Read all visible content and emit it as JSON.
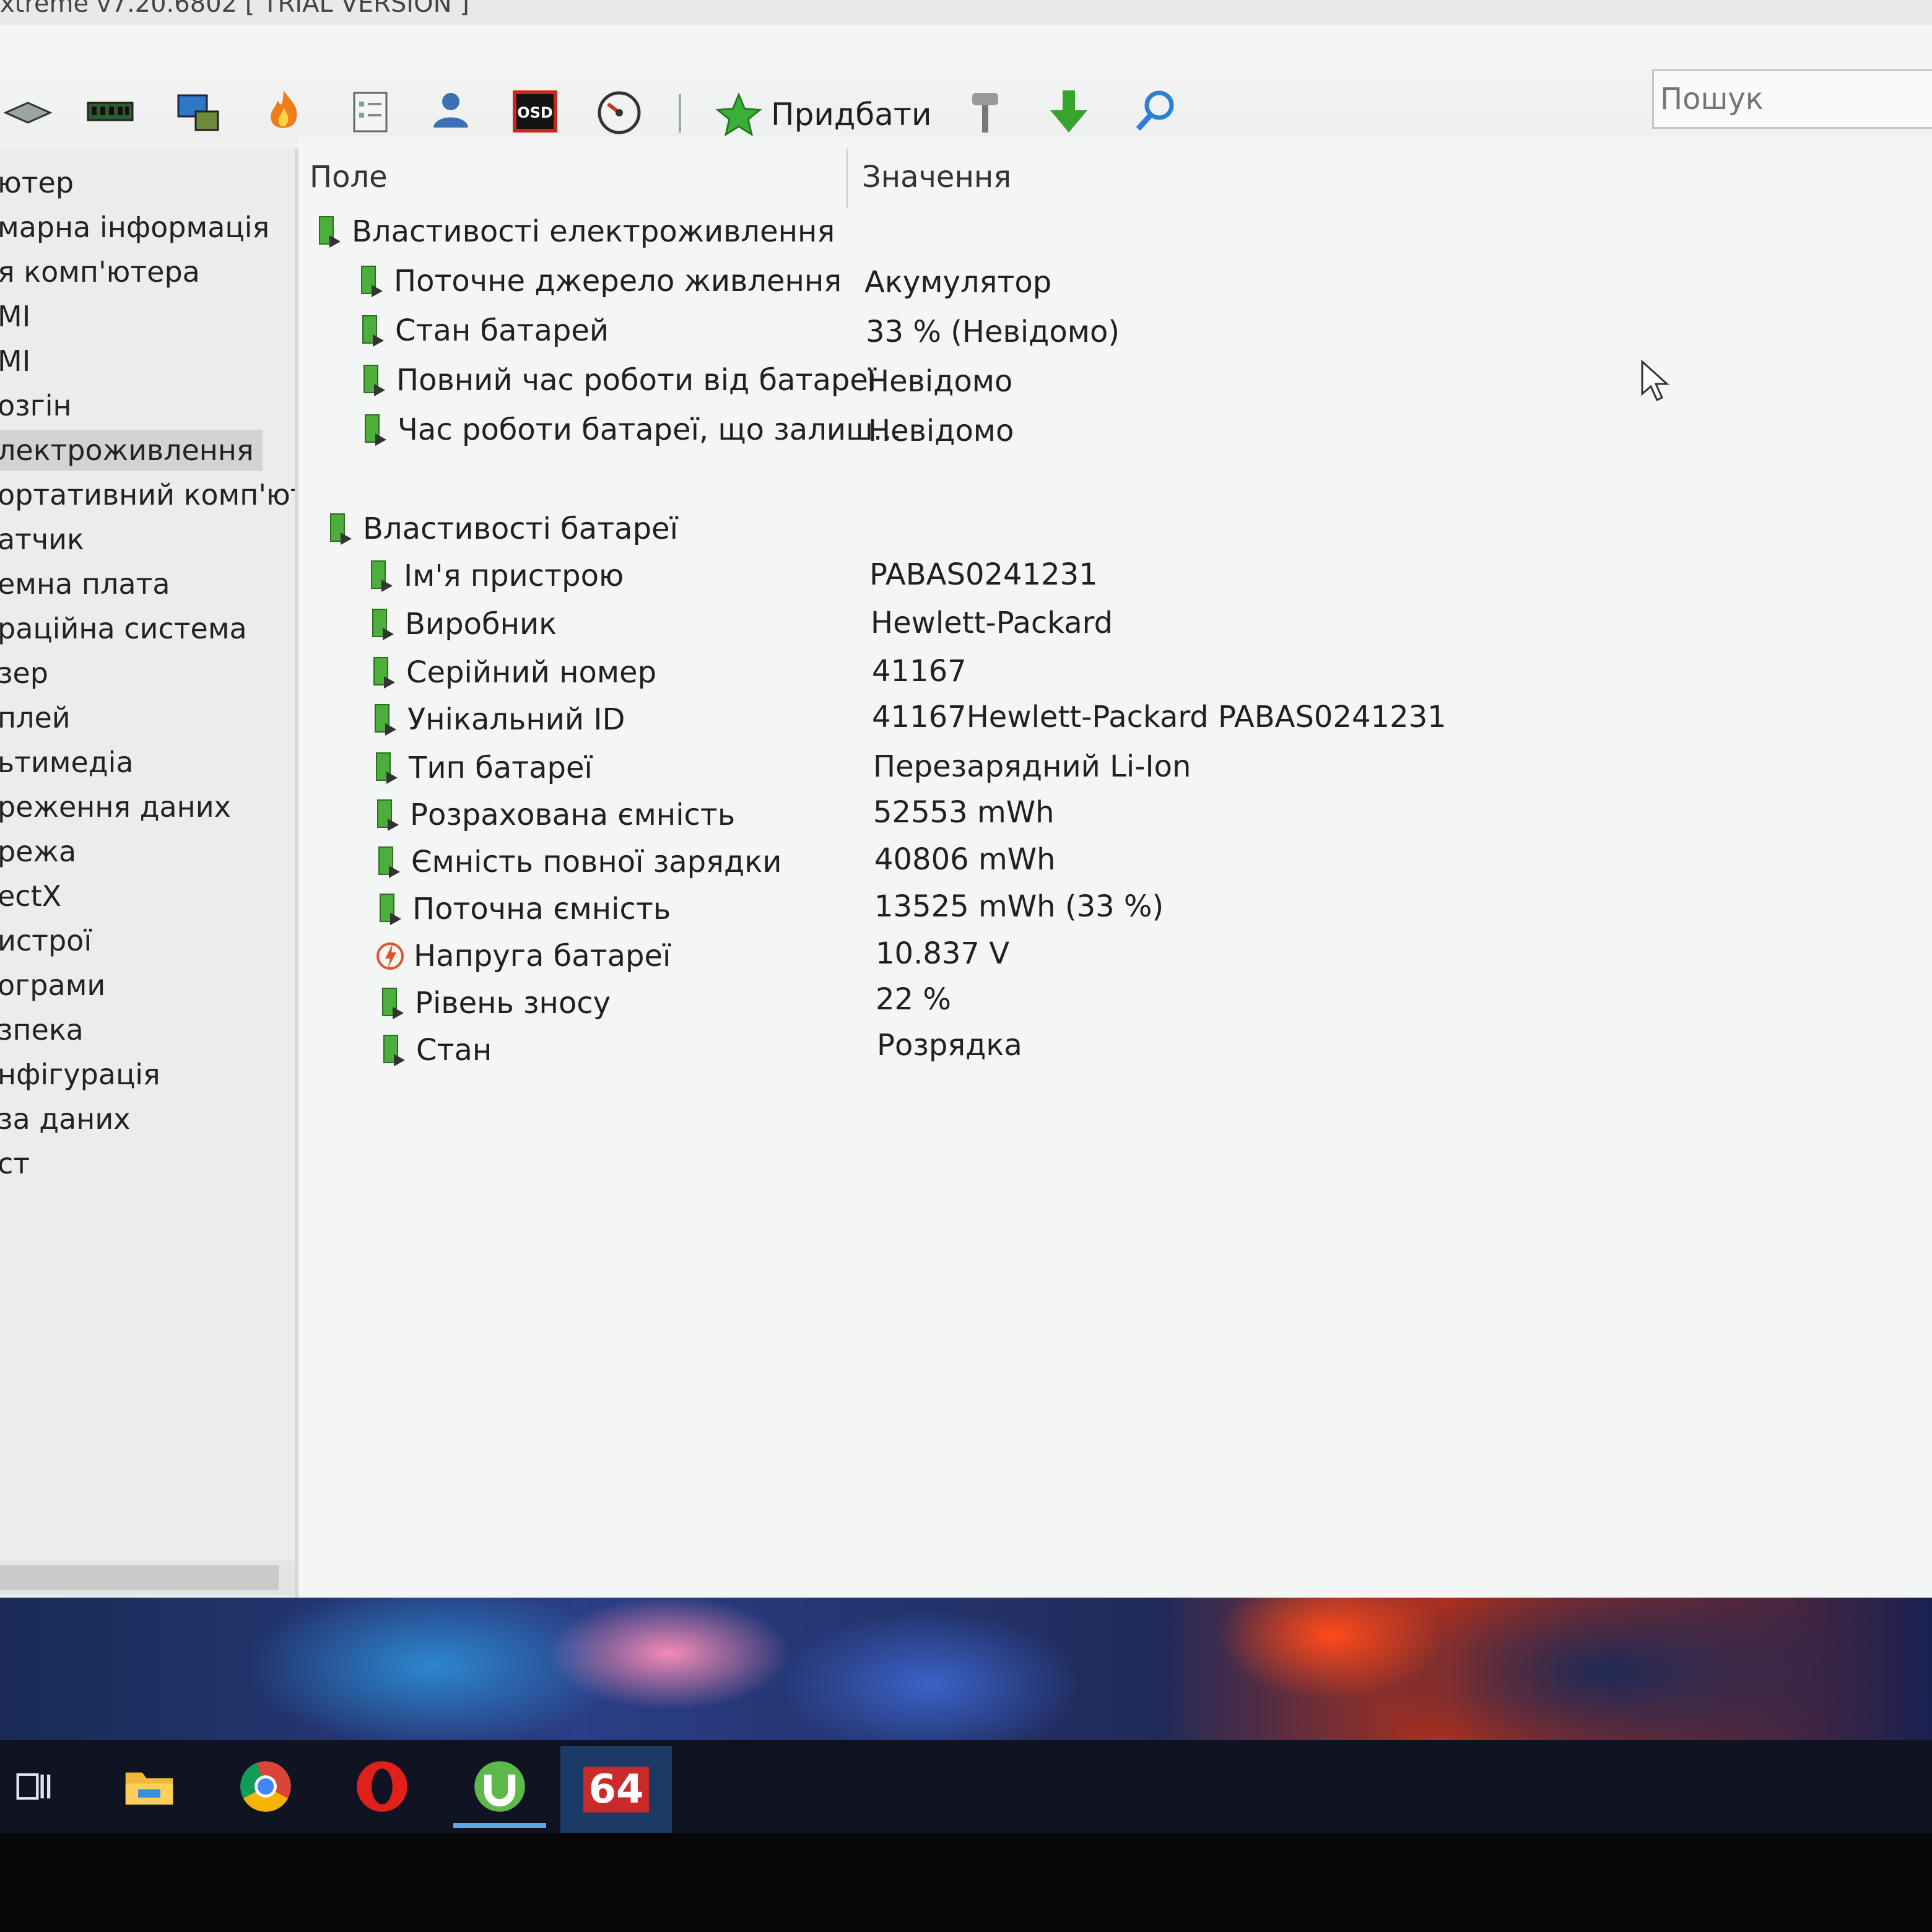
{
  "window": {
    "title": "xtreme v7.20.6802  [ TRIAL VERSION ]"
  },
  "toolbar": {
    "icons": [
      "board-icon",
      "memory-icon",
      "computer-icon",
      "flame-icon",
      "report-icon",
      "user-icon",
      "osd-icon",
      "gauge-icon"
    ],
    "add_label": "Придбати",
    "search_placeholder": "Пошук"
  },
  "sidebar": {
    "items": [
      "ютер",
      "марна інформація",
      "я комп'ютера",
      "MI",
      "MI",
      "озгін",
      "лектроживлення",
      "ортативний комп'юте",
      "атчик",
      "емна плата",
      "раційна система",
      "зер",
      "плей",
      "ьтимедіа",
      "реження даних",
      "режа",
      "ectX",
      "истрої",
      "ограми",
      "зпека",
      "нфігурація",
      "за даних",
      "ст"
    ],
    "selected_index": 6
  },
  "table": {
    "col_field": "Поле",
    "col_value": "Значення",
    "groups": [
      {
        "title": "Властивості електроживлення",
        "rows": [
          {
            "field": "Поточне джерело живлення",
            "value": "Акумулятор"
          },
          {
            "field": "Стан батарей",
            "value": "33 % (Невідомо)"
          },
          {
            "field": "Повний час роботи від батареї",
            "value": "Невідомо"
          },
          {
            "field": "Час роботи батареї, що залиш...",
            "value": "Невідомо"
          }
        ]
      },
      {
        "title": "Властивості батареї",
        "rows": [
          {
            "field": "Ім'я пристрою",
            "value": "PABAS0241231"
          },
          {
            "field": "Виробник",
            "value": "Hewlett-Packard"
          },
          {
            "field": "Серійний номер",
            "value": "41167"
          },
          {
            "field": "Унікальний ID",
            "value": "41167Hewlett-Packard PABAS0241231"
          },
          {
            "field": "Тип батареї",
            "value": "Перезарядний Li-Ion"
          },
          {
            "field": "Розрахована ємність",
            "value": "52553 mWh"
          },
          {
            "field": "Ємність повної зарядки",
            "value": "40806 mWh"
          },
          {
            "field": "Поточна ємність",
            "value": "13525 mWh  (33 %)"
          },
          {
            "field": "Напруга батареї",
            "value": "10.837 V"
          },
          {
            "field": "Рівень зносу",
            "value": "22 %"
          },
          {
            "field": "Стан",
            "value": "Розрядка"
          }
        ]
      }
    ]
  },
  "taskbar": {
    "aida_label": "64",
    "items": [
      "task-view-icon",
      "file-explorer-icon",
      "chrome-icon",
      "opera-icon",
      "utorrent-icon",
      "aida64-icon"
    ]
  }
}
